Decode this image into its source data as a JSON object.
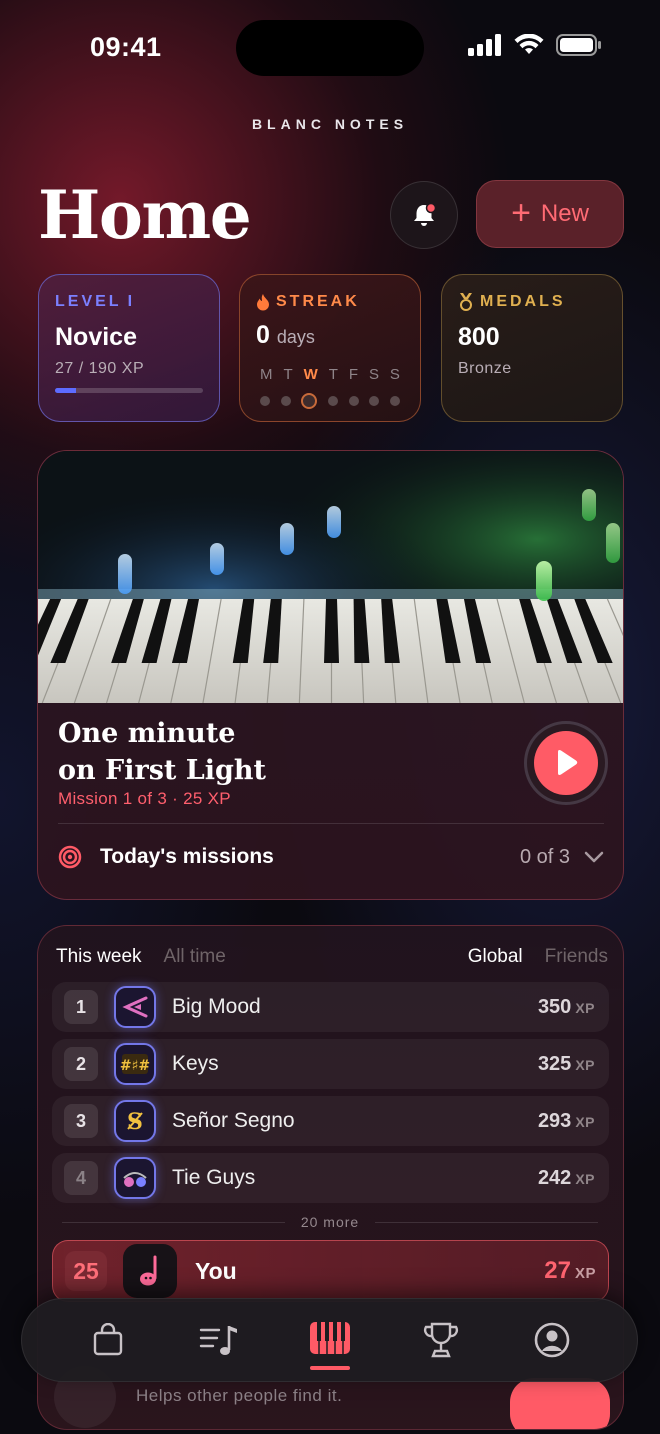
{
  "status": {
    "time": "09:41"
  },
  "brand": "BLANC NOTES",
  "header": {
    "title": "Home",
    "new_label": "New"
  },
  "cards": {
    "level": {
      "label": "LEVEL",
      "label_icon": "I",
      "value": "Novice",
      "xp": "27 / 190 XP",
      "progress": 0.142
    },
    "streak": {
      "label": "STREAK",
      "count": "0",
      "unit": "days",
      "weekdays": [
        "M",
        "T",
        "W",
        "T",
        "F",
        "S",
        "S"
      ],
      "today_index": 2
    },
    "medals": {
      "label": "MEDALS",
      "value": "800",
      "tier": "Bronze"
    }
  },
  "mission": {
    "title_line1": "One minute",
    "title_line2": "on First Light",
    "meta": "Mission 1 of 3 · 25 XP",
    "todays_label": "Today's missions",
    "todays_count": "0 of 3"
  },
  "leaderboard": {
    "period_tabs": [
      "This week",
      "All time"
    ],
    "scope_tabs": [
      "Global",
      "Friends"
    ],
    "xp_unit": "XP",
    "rows": [
      {
        "rank": "1",
        "name": "Big Mood",
        "xp": "350"
      },
      {
        "rank": "2",
        "name": "Keys",
        "xp": "325"
      },
      {
        "rank": "3",
        "name": "Señor Segno",
        "xp": "293"
      },
      {
        "rank": "4",
        "name": "Tie Guys",
        "xp": "242"
      }
    ],
    "more": "20 more",
    "you": {
      "rank": "25",
      "name": "You",
      "xp": "27"
    }
  },
  "hint": "Helps other people find it.",
  "tabbar": [
    "bag-icon",
    "music-list-icon",
    "piano-icon",
    "trophy-icon",
    "profile-icon"
  ],
  "colors": {
    "accent": "#ff5a66",
    "level": "#6b72ff",
    "streak": "#ff8a4a",
    "medals": "#e0b050"
  }
}
